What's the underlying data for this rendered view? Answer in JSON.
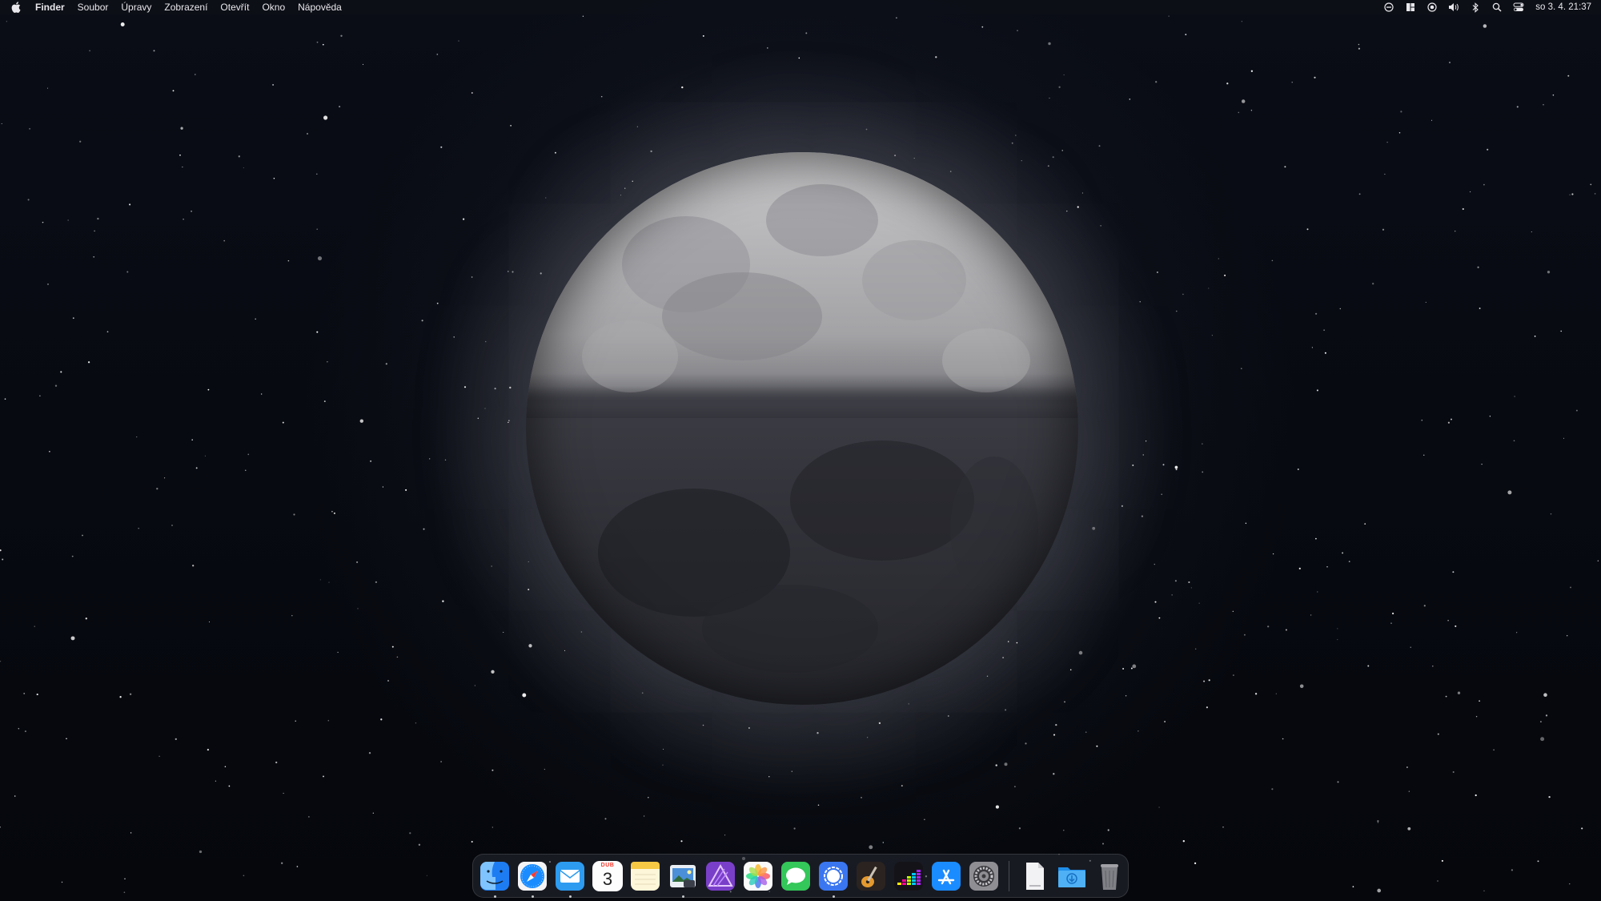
{
  "menubar": {
    "app_name": "Finder",
    "items": [
      "Soubor",
      "Úpravy",
      "Zobrazení",
      "Otevřít",
      "Okno",
      "Nápověda"
    ],
    "status_icons": [
      "do-not-disturb-icon",
      "window-tiling-icon",
      "screen-record-icon",
      "volume-icon",
      "bluetooth-icon",
      "spotlight-search-icon",
      "control-center-icon"
    ],
    "clock": "so 3. 4.  21:37"
  },
  "dock": {
    "apps": [
      {
        "name": "Finder",
        "icon": "finder-icon",
        "running": true
      },
      {
        "name": "Safari",
        "icon": "safari-icon",
        "running": true
      },
      {
        "name": "Mail",
        "icon": "mail-icon",
        "running": true
      },
      {
        "name": "Kalendář",
        "icon": "calendar-icon",
        "running": false,
        "month": "DUB",
        "day": "3"
      },
      {
        "name": "Poznámky",
        "icon": "notes-icon",
        "running": false
      },
      {
        "name": "Náhled",
        "icon": "preview-icon",
        "running": true
      },
      {
        "name": "Affinity Photo",
        "icon": "affinity-photo-icon",
        "running": false
      },
      {
        "name": "Fotky",
        "icon": "photos-icon",
        "running": false
      },
      {
        "name": "Zprávy",
        "icon": "messages-icon",
        "running": false
      },
      {
        "name": "Signal",
        "icon": "signal-icon",
        "running": true
      },
      {
        "name": "GarageBand",
        "icon": "garageband-icon",
        "running": false
      },
      {
        "name": "Deezer",
        "icon": "deezer-icon",
        "running": false
      },
      {
        "name": "App Store",
        "icon": "app-store-icon",
        "running": false
      },
      {
        "name": "Předvolby systému",
        "icon": "system-preferences-icon",
        "running": false
      }
    ],
    "stack_items": [
      {
        "name": "Dokument",
        "icon": "document-icon"
      },
      {
        "name": "Stažené soubory",
        "icon": "downloads-folder-icon"
      },
      {
        "name": "Koš",
        "icon": "trash-icon"
      }
    ]
  },
  "colors": {
    "menubar_bg": "#0e1018",
    "accent_blue": "#1a8cff",
    "calendar_red": "#ff3b30"
  }
}
